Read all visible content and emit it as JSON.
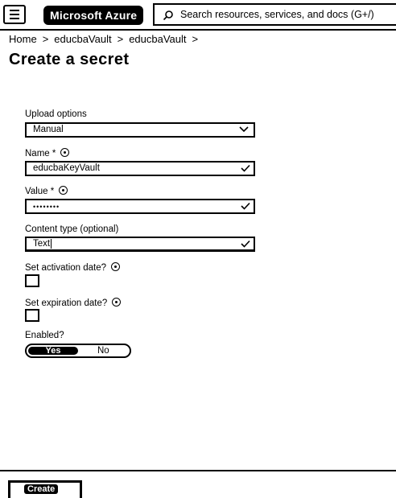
{
  "header": {
    "brand": "Microsoft Azure",
    "search_placeholder": "Search resources, services, and docs (G+/)"
  },
  "breadcrumb": [
    "Home",
    "educbaVault",
    "educbaVault"
  ],
  "page_title": "Create a secret",
  "form": {
    "upload_options": {
      "label": "Upload options",
      "value": "Manual"
    },
    "name": {
      "label": "Name *",
      "value": "educbaKeyVault"
    },
    "value": {
      "label": "Value *",
      "value": "••••••••"
    },
    "content_type": {
      "label": "Content type (optional)",
      "value": "Text"
    },
    "activation_date": {
      "label": "Set activation date?",
      "checked": false
    },
    "expiration_date": {
      "label": "Set expiration date?",
      "checked": false
    },
    "enabled": {
      "label": "Enabled?",
      "options": [
        "Yes",
        "No"
      ],
      "selected": "Yes"
    }
  },
  "footer": {
    "create_label": "Create"
  }
}
